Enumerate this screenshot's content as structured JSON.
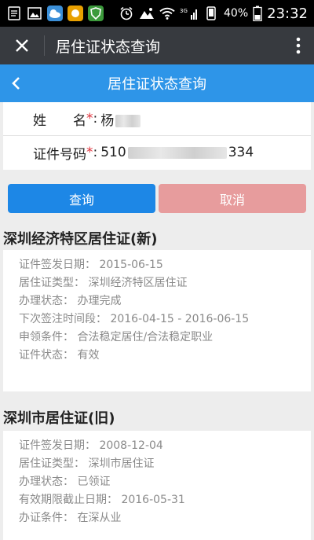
{
  "status_bar": {
    "time": "23:32",
    "battery_percent": "40%",
    "network_label": "3G",
    "icons": [
      "notification-icon",
      "image-icon",
      "weather-icon",
      "app-icon",
      "shield-app-icon",
      "alarm-icon",
      "mountain-icon",
      "wifi-icon",
      "signal-icon",
      "phone-icon",
      "battery-icon"
    ]
  },
  "titlebar": {
    "title": "居住证状态查询"
  },
  "header": {
    "title": "居住证状态查询"
  },
  "form": {
    "name_label": "姓　　名",
    "name_required_mark": "*",
    "name_colon": ":",
    "name_value_visible": "杨",
    "id_label": "证件号码",
    "id_required_mark": "*",
    "id_colon": ":",
    "id_prefix": "510",
    "id_suffix": "334"
  },
  "buttons": {
    "query": "查询",
    "cancel": "取消"
  },
  "permit_new": {
    "title": "深圳经济特区居住证(新)",
    "lines": [
      "证件签发日期： 2015-06-15",
      "居住证类型： 深圳经济特区居住证",
      "办理状态： 办理完成",
      "下次签注时间段： 2016-04-15 - 2016-06-15",
      "申领条件： 合法稳定居住/合法稳定职业",
      "证件状态： 有效"
    ]
  },
  "permit_old": {
    "title": "深圳市居住证(旧)",
    "lines": [
      "证件签发日期： 2008-12-04",
      "居住证类型： 深圳市居住证",
      "办理状态： 已领证",
      "有效期限截止日期： 2016-05-31",
      "办证条件： 在深从业"
    ]
  },
  "colors": {
    "blue_header": "#2e95e8",
    "query_button": "#1d87e6",
    "cancel_button": "#e79c9d",
    "required": "#e0303a"
  }
}
